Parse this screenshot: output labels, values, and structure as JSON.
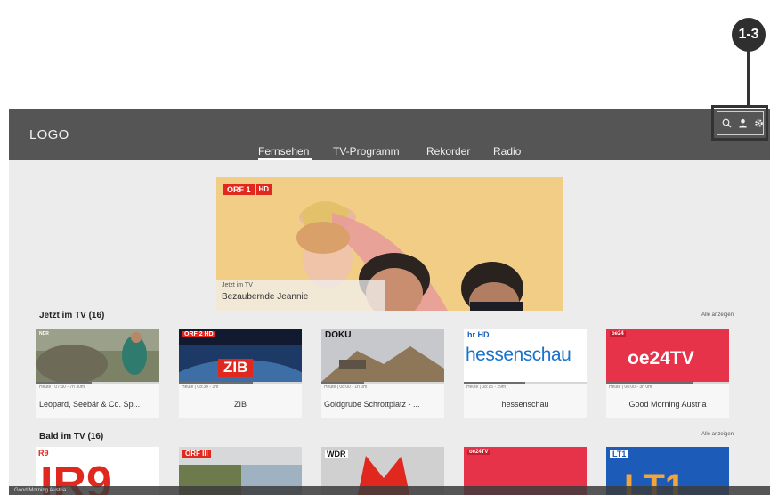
{
  "callout": {
    "label": "1-3"
  },
  "app": {
    "logo": "LOGO"
  },
  "nav": {
    "items": [
      "Fernsehen",
      "TV-Programm",
      "Rekorder",
      "Radio"
    ]
  },
  "icons": {
    "search": "search-icon",
    "user": "user-icon",
    "settings": "gear-icon"
  },
  "hero": {
    "brand": "ORF 1",
    "brand_hd": "HD",
    "subtitle": "Jetzt im TV",
    "title": "Bezaubernde Jeannie"
  },
  "sections": {
    "now": {
      "title": "Jetzt im TV (16)",
      "link": "Alle anzeigen"
    },
    "soon": {
      "title": "Bald im TV (16)",
      "link": "Alle anzeigen"
    }
  },
  "now_cards": [
    {
      "meta": "Heute | 07:30 - 7h 30m",
      "title": "Leopard, Seebär & Co. Sp...",
      "progress": 0.45,
      "channel": "NDR"
    },
    {
      "meta": "Heute | 08:30 - 3m",
      "title": "ZIB",
      "progress": 0.6,
      "channel": "ORF 2 HD",
      "overlay": "ZIB"
    },
    {
      "meta": "Heute | 08:00 - 1h 0m",
      "title": "Goldgrube Schrottplatz - ...",
      "progress": 0.35,
      "channel": "DOKU"
    },
    {
      "meta": "Heute | 08:15 - 29m",
      "title": "hessenschau",
      "progress": 0.5,
      "channel": "hr HD",
      "overlay": "hessenschau"
    },
    {
      "meta": "Heute | 06:00 - 3h 0m",
      "title": "Good Morning Austria",
      "progress": 0.7,
      "channel": "oe24",
      "overlay": "oe24TV"
    }
  ],
  "bottom_cards": [
    "R9",
    "ORF III",
    "WDR",
    "oe24TV",
    "LT1"
  ],
  "bottom_text": "Good Morning Austria",
  "colors": {
    "header": "#555555",
    "accent_red": "#e1281e",
    "background": "#ececec"
  }
}
